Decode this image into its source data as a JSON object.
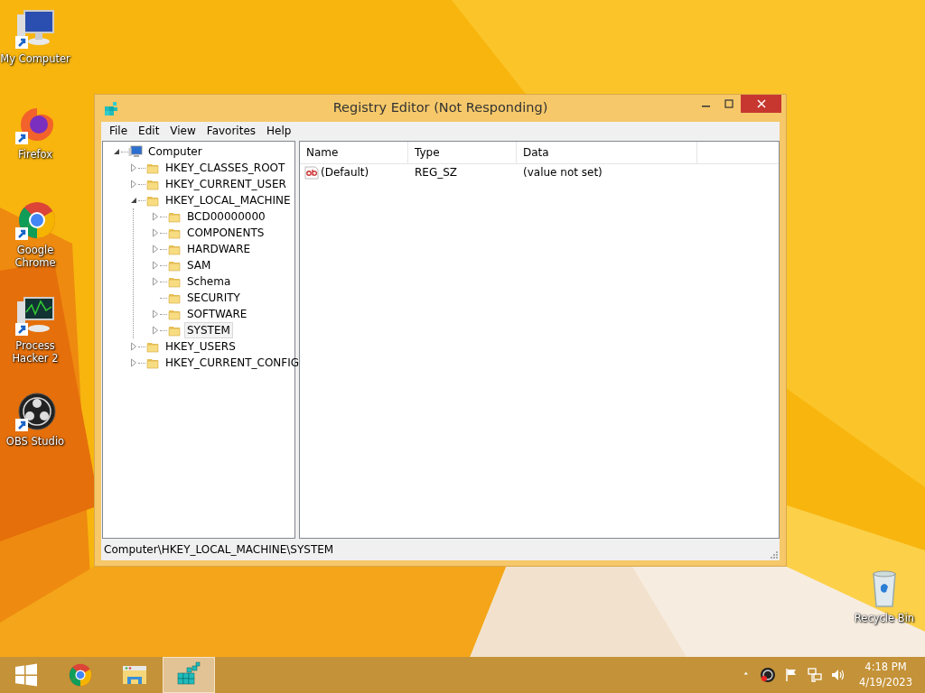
{
  "desktop_icons": [
    {
      "label": "My Computer",
      "kind": "computer"
    },
    {
      "label": "Firefox",
      "kind": "firefox"
    },
    {
      "label": "Google Chrome",
      "kind": "chrome"
    },
    {
      "label": "Process Hacker 2",
      "kind": "processhacker"
    },
    {
      "label": "OBS Studio",
      "kind": "obs"
    }
  ],
  "recycle_bin": {
    "label": "Recycle Bin"
  },
  "window": {
    "title": "Registry Editor (Not Responding)",
    "menu": [
      "File",
      "Edit",
      "View",
      "Favorites",
      "Help"
    ],
    "tree": [
      {
        "label": "Computer",
        "kind": "computer",
        "expandable": true,
        "expanded": true,
        "selected": false,
        "children": [
          {
            "label": "HKEY_CLASSES_ROOT",
            "expandable": true,
            "expanded": false,
            "selected": false
          },
          {
            "label": "HKEY_CURRENT_USER",
            "expandable": true,
            "expanded": false,
            "selected": false
          },
          {
            "label": "HKEY_LOCAL_MACHINE",
            "expandable": true,
            "expanded": true,
            "selected": false,
            "children": [
              {
                "label": "BCD00000000",
                "expandable": true,
                "expanded": false,
                "selected": false
              },
              {
                "label": "COMPONENTS",
                "expandable": true,
                "expanded": false,
                "selected": false
              },
              {
                "label": "HARDWARE",
                "expandable": true,
                "expanded": false,
                "selected": false
              },
              {
                "label": "SAM",
                "expandable": true,
                "expanded": false,
                "selected": false
              },
              {
                "label": "Schema",
                "expandable": true,
                "expanded": false,
                "selected": false
              },
              {
                "label": "SECURITY",
                "expandable": false,
                "selected": false
              },
              {
                "label": "SOFTWARE",
                "expandable": true,
                "expanded": false,
                "selected": false
              },
              {
                "label": "SYSTEM",
                "expandable": true,
                "expanded": false,
                "selected": true
              }
            ]
          },
          {
            "label": "HKEY_USERS",
            "expandable": true,
            "expanded": false,
            "selected": false
          },
          {
            "label": "HKEY_CURRENT_CONFIG",
            "expandable": true,
            "expanded": false,
            "selected": false
          }
        ]
      }
    ],
    "list": {
      "columns": [
        "Name",
        "Type",
        "Data"
      ],
      "rows": [
        {
          "name": "(Default)",
          "type": "REG_SZ",
          "data": "(value not set)"
        }
      ]
    },
    "status_bar": "Computer\\HKEY_LOCAL_MACHINE\\SYSTEM"
  },
  "taskbar": {
    "apps": [
      {
        "kind": "start",
        "selected": false
      },
      {
        "kind": "chrome",
        "selected": false
      },
      {
        "kind": "explorer",
        "selected": false
      },
      {
        "kind": "regedit",
        "selected": true
      }
    ],
    "time": "4:18 PM",
    "date": "4/19/2023"
  }
}
